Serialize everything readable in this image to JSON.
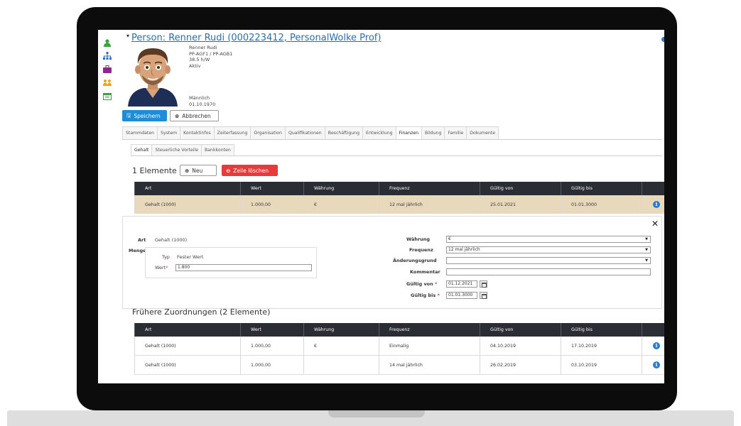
{
  "person": {
    "title": "Person: Renner Rudi (000223412, PersonalWolke Prof)",
    "name": "Renner Rudi",
    "org": "PP-AGF1 / PP-AGB1",
    "hours": "38.5 h/W",
    "status": "Aktiv",
    "gender": "Männlich",
    "birthdate": "01.10.1970"
  },
  "actions": {
    "save": "Speichern",
    "cancel": "Abbrechen"
  },
  "tabs": [
    "Stammdaten",
    "System",
    "Kontaktinfos",
    "Zeiterfassung",
    "Organisation",
    "Qualifikationen",
    "Beschäftigung",
    "Entwicklung",
    "Finanzen",
    "Bildung",
    "Familie",
    "Dokumente"
  ],
  "subtabs": [
    "Gehalt",
    "Steuerliche Vorteile",
    "Bankkonten"
  ],
  "elements": {
    "title": "1 Elemente",
    "new": "Neu",
    "delete": "Zeile löschen"
  },
  "columns": [
    "Art",
    "Wert",
    "Währung",
    "Frequenz",
    "Gültig von",
    "Gültig bis"
  ],
  "current_rows": [
    [
      "Gehalt (1000)",
      "1.000,00",
      "€",
      "12 mal jährlich",
      "25.01.2021",
      "01.01.3000"
    ]
  ],
  "detail": {
    "art_label": "Art",
    "art_value": "Gehalt (1000)",
    "menge_label": "Menge",
    "typ_label": "Typ",
    "typ_value": "Fester Wert",
    "wert_label": "Wert",
    "wert_value": "1.800",
    "waehrung_label": "Währung",
    "waehrung_value": "€",
    "frequenz_label": "Frequenz",
    "frequenz_value": "12 mal jährlich",
    "aenderungsgrund_label": "Änderungsgrund",
    "aenderungsgrund_value": "",
    "kommentar_label": "Kommentar",
    "kommentar_value": "",
    "gueltig_von_label": "Gültig von",
    "gueltig_von_value": "01.12.2021",
    "gueltig_bis_label": "Gültig bis",
    "gueltig_bis_value": "01.01.3000"
  },
  "previous": {
    "title": "Frühere Zuordnungen (2 Elemente)",
    "rows": [
      [
        "Gehalt (1000)",
        "1.000,00",
        "€",
        "Einmalig",
        "04.10.2019",
        "17.10.2019"
      ],
      [
        "Gehalt (1000)",
        "1.000,00",
        "",
        "14 mal jährlich",
        "26.02.2019",
        "03.10.2019"
      ]
    ]
  },
  "icons": {
    "rail": [
      "person-icon",
      "org-chart-icon",
      "briefcase-icon",
      "team-icon",
      "calendar-icon"
    ],
    "info": "i"
  },
  "colors": {
    "accent_blue": "#1f8dd6",
    "danger": "#e83a3a",
    "header_dark": "#2a2d34",
    "selected_row": "#e8d9bd"
  }
}
